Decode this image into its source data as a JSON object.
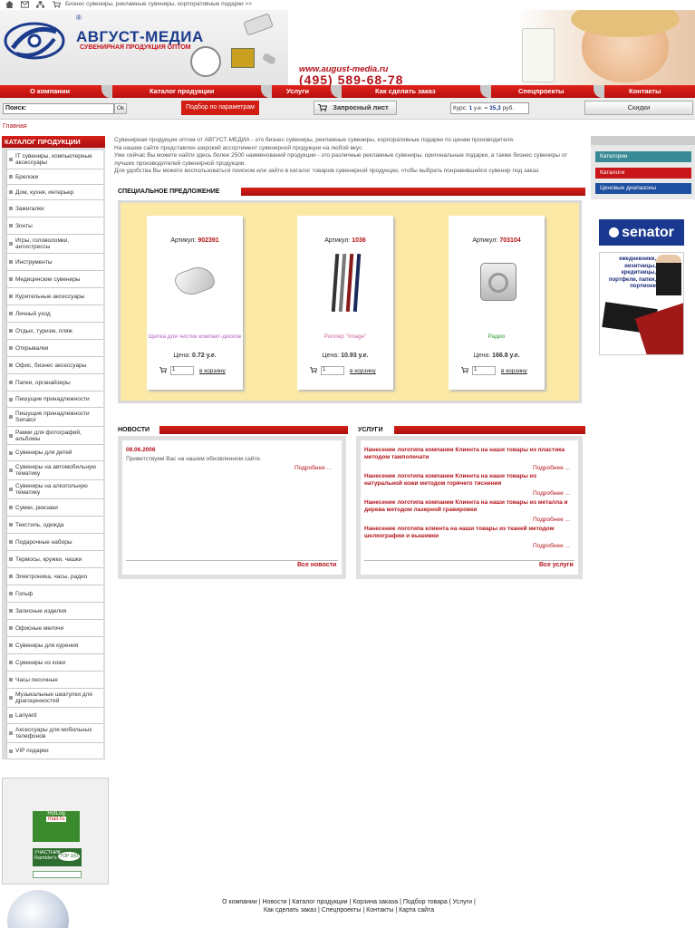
{
  "topbar": {
    "crumb": "Бизнес сувениры, рекламные сувениры, корпоративные подарки >>"
  },
  "logo": {
    "name": "АВГУСТ-МЕДИА",
    "tagline": "СУВЕНИРНАЯ ПРОДУКЦИЯ ОПТОМ",
    "reg": "®"
  },
  "contact": {
    "url": "www.august-media.ru",
    "phone": "(495) 589-68-78"
  },
  "nav": [
    "О компании",
    "Каталог продукции",
    "Услуги",
    "Как сделать заказ",
    "Спецпроекты",
    "Контакты"
  ],
  "searchbar": {
    "search_label": "Поиск:",
    "ok_label": "Ok",
    "filter_label": "Подбор по параметрам",
    "request_label": "Запросный лист",
    "rate_prefix": "Курс:",
    "rate_unit": "1",
    "rate_mid": "у.е. =",
    "rate_value": "35,3",
    "rate_suffix": "руб.",
    "discounts_label": "Скидки"
  },
  "breadcrumb": "Главная",
  "catalog": {
    "title": "КАТАЛОГ ПРОДУКЦИИ",
    "items": [
      "IT сувениры, компьютерные аксессуары",
      "Брелоки",
      "Дом, кухня, интерьер",
      "Зажигалки",
      "Зонты",
      "Игры, головоломки, антистрессы",
      "Инструменты",
      "Медицинские сувениры",
      "Курительные аксессуары",
      "Личный уход",
      "Отдых, туризм, пляж",
      "Открывалки",
      "Офис, бизнес аксессуары",
      "Папки, органайзеры",
      "Пишущие принадлежности",
      "Пишущие принадлежности Senator",
      "Рамки для фотографий, альбомы",
      "Сувениры для детей",
      "Сувениры на автомобильную тематику",
      "Сувениры на алкогольную тематику",
      "Сумки, рюкзаки",
      "Текстиль, одежда",
      "Подарочные наборы",
      "Термосы, кружки, чашки",
      "Электроника, часы, радио",
      "Гольф",
      "Записные изделия",
      "Офисные мелочи",
      "Сувениры для курения",
      "Сувениры из кожи",
      "Часы песочные",
      "Музыкальные шкатулки для драгоценностей",
      "Lanyard",
      "Аксессуары для мобильных телефонов",
      "VIP подарки"
    ]
  },
  "intro": [
    "Сувенирная продукция оптом от АВГУСТ-МЕДИА - это бизнес сувениры, рекламные сувениры, корпоративные подарки по ценам производителя.",
    "На нашем сайте представлен широкий ассортимент сувенирной продукции на любой вкус.",
    "Уже сейчас Вы можете найти здесь более 2500 наименований продукции - это различные рекламные сувениры, оригинальные подарки, а также бизнес сувениры от лучших производителей сувенирной продукции.",
    "Для удобства Вы можете воспользоваться поиском или зайти в каталог товаров сувенирной продукции, чтобы выбрать понравившийся сувенир под заказ."
  ],
  "special": {
    "title": "СПЕЦИАЛЬНОЕ ПРЕДЛОЖЕНИЕ",
    "article_label": "Артикул:",
    "price_label": "Цена:",
    "cart_label": "в корзину",
    "qty_default": "1",
    "products": [
      {
        "article": "902391",
        "name": "Щетка для чистки компакт-дисков",
        "price": "0.72 у.е.",
        "name_color": "#b060c0"
      },
      {
        "article": "1036",
        "name": "Роллер \"Image\"",
        "price": "10.93 у.е.",
        "name_color": "#d060a0"
      },
      {
        "article": "703104",
        "name": "Радио",
        "price": "166.8 у.е.",
        "name_color": "#2a9a2a"
      }
    ]
  },
  "news": {
    "title": "НОВОСТИ",
    "date": "08.06.2006",
    "text": "Приветствуем Вас на нашем обновленном сайте.",
    "more": "Подробнее ...",
    "all": "Все новости"
  },
  "services": {
    "title": "УСЛУГИ",
    "items": [
      "Нанесение логотипа компании Клиента на наши товары из пластика методом тампопечати",
      "Нанесение логотипа компании Клиента на наши товары из натуральной кожи методом горячего тиснения",
      "Нанесение логотипа компании Клиента на наши товары из металла и дерева методом лазерной гравировки",
      "Нанесение логотипа клиента на наши товары из тканей методом шелкографии и вышивки"
    ],
    "more": "Подробнее ...",
    "all": "Все услуги"
  },
  "right": {
    "links": [
      {
        "label": "Категории",
        "color": "#3a8a96"
      },
      {
        "label": "Каталоги",
        "color": "#c8161a"
      },
      {
        "label": "Ценовые диапазоны",
        "color": "#1f4fa0"
      }
    ],
    "senator": "senator",
    "banner_text": "ежедневники, визитницы, кредитницы, портфели, папки, портмоне"
  },
  "counters": {
    "top": "TOP 100",
    "rambler": "УЧАСТНИК Rambler's",
    "mailru": "mail.ru",
    "hotlog": "HotLog"
  },
  "footer": {
    "row1": [
      "О компании",
      "Новости",
      "Каталог продукции",
      "Корзина заказа",
      "Подбор товара",
      "Услуги"
    ],
    "row2": [
      "Как сделать заказ",
      "Спецпроекты",
      "Контакты",
      "Карта сайта"
    ]
  }
}
